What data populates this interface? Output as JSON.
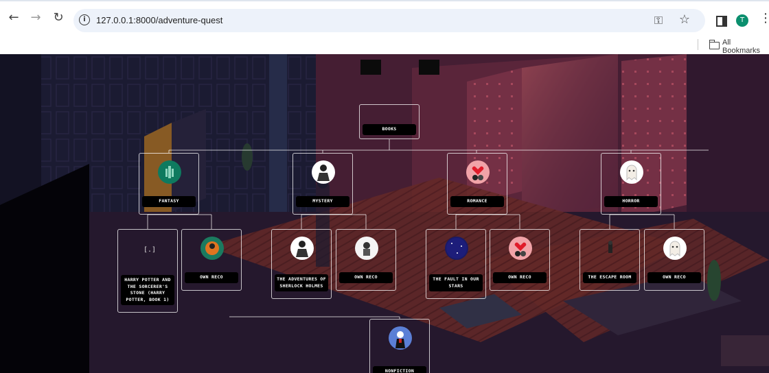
{
  "browser": {
    "url": "127.0.0.1:8000/adventure-quest",
    "avatar_letter": "T",
    "bookmarks_label": "All Bookmarks",
    "icons": [
      "back-arrow-icon",
      "forward-arrow-icon",
      "reload-icon",
      "site-info-icon",
      "password-key-icon",
      "bookmark-star-icon",
      "side-panel-icon",
      "kebab-menu-icon",
      "bookmark-folder-icon"
    ]
  },
  "tree": {
    "root": {
      "label": "Books"
    },
    "genres": [
      {
        "label": "Fantasy",
        "icon": "fantasy-icon",
        "color": "#0e7a5f"
      },
      {
        "label": "Mystery",
        "icon": "mystery-icon",
        "color": "#ffffff"
      },
      {
        "label": "Romance",
        "icon": "romance-icon",
        "color": "#f1a3a8"
      },
      {
        "label": "Horror",
        "icon": "horror-icon",
        "color": "#ffffff"
      }
    ],
    "books": [
      {
        "label": "Harry Potter and the Sorcerer's Stone (Harry Potter, Book 1)",
        "icon": "harry-potter-icon"
      },
      {
        "label": "Own Reco",
        "icon": "own-reco-fantasy-icon"
      },
      {
        "label": "The Adventures of Sherlock Holmes",
        "icon": "sherlock-icon"
      },
      {
        "label": "Own Reco",
        "icon": "own-reco-mystery-icon"
      },
      {
        "label": "The Fault in Our Stars",
        "icon": "fault-stars-icon"
      },
      {
        "label": "Own Reco",
        "icon": "own-reco-romance-icon"
      },
      {
        "label": "The Escape Room",
        "icon": "escape-room-icon"
      },
      {
        "label": "Own Reco",
        "icon": "own-reco-horror-icon"
      }
    ],
    "nonfiction": {
      "label": "Nonfiction",
      "icon": "nonfiction-icon"
    }
  },
  "scene": {
    "background": "pixel-art-room-background"
  }
}
